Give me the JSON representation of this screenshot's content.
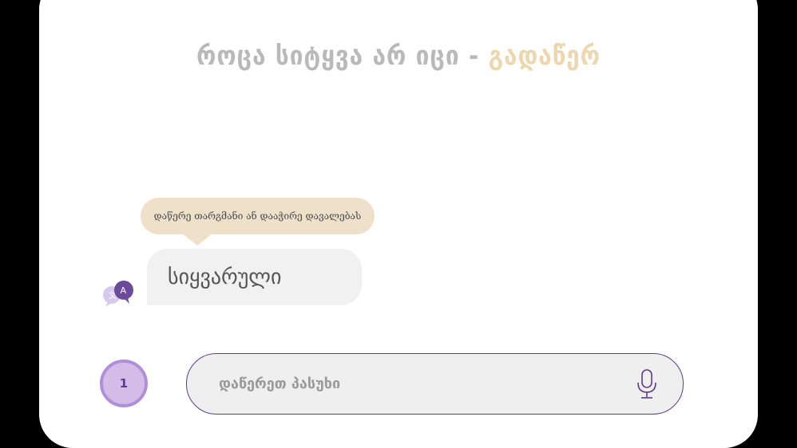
{
  "header": {
    "title_main": "როცა სიტყვა არ იცი - ",
    "title_accent": "გადაწერ"
  },
  "hint": {
    "text": "დაწერე თარგმანი ან დააჭირე დავალებას"
  },
  "prompt": {
    "word": "სიყვარული"
  },
  "translate_icon": {
    "icon": "translate-icon",
    "letter": "A"
  },
  "answer": {
    "placeholder": "დაწერეთ პასუხი",
    "value": ""
  },
  "counter": {
    "value": "1"
  },
  "colors": {
    "background": "#000000",
    "card": "#ffffff",
    "title": "#b9b9b9",
    "accent": "#edd7ae",
    "hint_bg": "#eee0c9",
    "bubble_bg": "#f1f1f1",
    "purple": "#5e3b8e",
    "counter_bg": "#d4bce9"
  }
}
